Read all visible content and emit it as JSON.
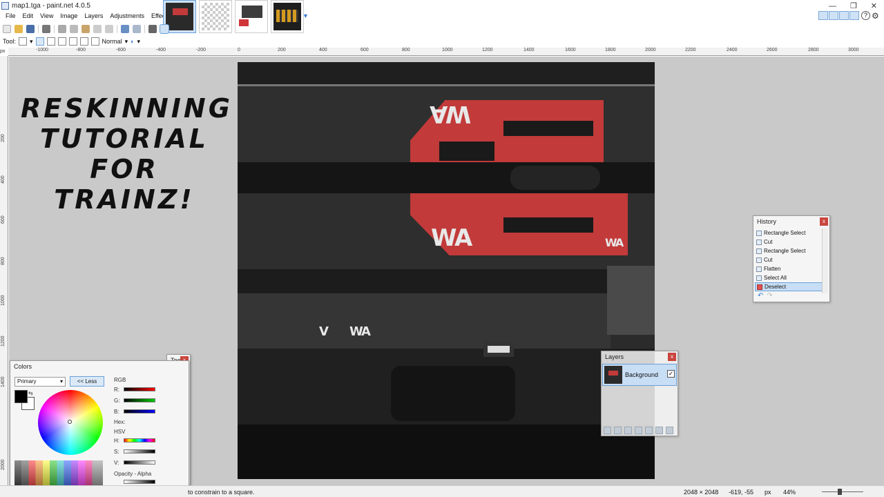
{
  "window": {
    "title": "map1.tga - paint.net 4.0.5",
    "controls": [
      "—",
      "❐",
      "✕"
    ]
  },
  "menu": [
    "File",
    "Edit",
    "View",
    "Image",
    "Layers",
    "Adjustments",
    "Effects"
  ],
  "toolbar2": {
    "tool_label": "Tool:",
    "blend_mode": "Normal"
  },
  "ruler": {
    "corner_unit": "px",
    "top_ticks": [
      "-1000",
      "-800",
      "-600",
      "-400",
      "-200",
      "0",
      "200",
      "400",
      "600",
      "800",
      "1000",
      "1200",
      "1400",
      "1600",
      "1800",
      "2000",
      "2200",
      "2400",
      "2600",
      "2800",
      "3000"
    ],
    "left_ticks": [
      "200",
      "400",
      "600",
      "800",
      "1000",
      "1200",
      "1400",
      "2000"
    ]
  },
  "headline": [
    "RESKINNING",
    "TUTORIAL",
    "FOR",
    "TRAINZ!"
  ],
  "canvas_text": {
    "logo_top": "WA",
    "logo_bottom": "WA",
    "logo_small": "WA",
    "logo_lower_1": "V",
    "logo_lower_2": "WA"
  },
  "history": {
    "title": "History",
    "items": [
      "Rectangle Select",
      "Cut",
      "Rectangle Select",
      "Cut",
      "Flatten",
      "Select All",
      "Deselect"
    ],
    "selected_index": 6
  },
  "layers": {
    "title": "Layers",
    "layer_name": "Background",
    "visible_mark": "✓"
  },
  "tools": {
    "title": "Tools"
  },
  "colors": {
    "title": "Colors",
    "mode": "Primary",
    "less_button": "<< Less",
    "rgb_label": "RGB",
    "r_label": "R:",
    "g_label": "G:",
    "b_label": "B:",
    "hex_label": "Hex:",
    "hsv_label": "HSV",
    "h_label": "H:",
    "s_label": "S:",
    "v_label": "V:",
    "opacity_label": "Opacity - Alpha",
    "primary_color": "#000000",
    "secondary_color": "#ffffff"
  },
  "status": {
    "hint": "to constrain to a square.",
    "image_size": "2048 × 2048",
    "cursor": "-619, -55",
    "unit": "px",
    "zoom": "44%"
  },
  "accent_color": "#3a7bd5",
  "livery_red": "#c23a3a"
}
